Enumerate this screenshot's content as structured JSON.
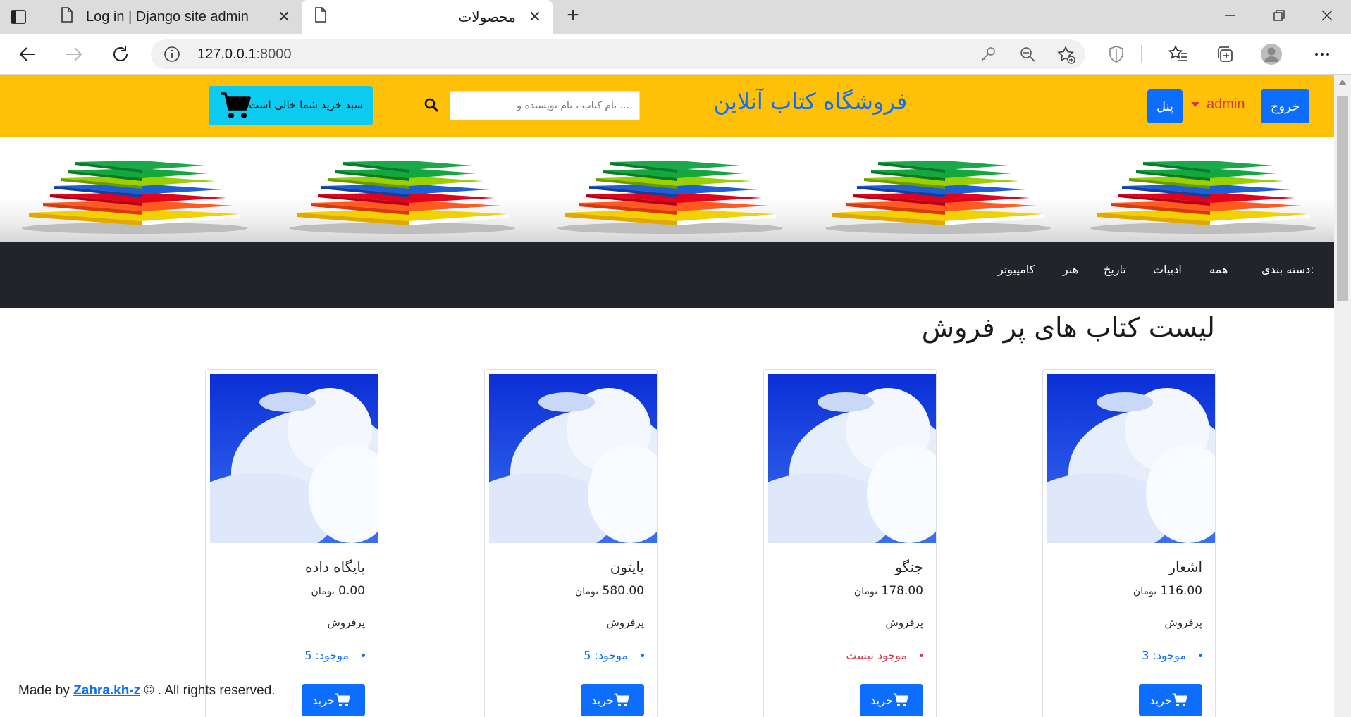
{
  "browser": {
    "tabs": [
      {
        "title": "Log in | Django site admin"
      },
      {
        "title": "محصولات"
      }
    ],
    "url_host": "127.0.0.1",
    "url_port": ":8000"
  },
  "header": {
    "logout_label": "خروج",
    "panel_label": "پنل",
    "user_label": "admin",
    "site_title": "فروشگاه کتاب آنلاین",
    "search_placeholder": "نام کتاب ، نام نویسنده و ...",
    "cart_label": "سبد خرید شما خالی است"
  },
  "categories": {
    "label": "دسته بندی:",
    "items": [
      "همه",
      "ادبیات",
      "تاریخ",
      "هنر",
      "کامپیوتر"
    ]
  },
  "main": {
    "list_title": "لیست کتاب های پر فروش",
    "products": [
      {
        "name": "اشعار",
        "price": "116.00",
        "currency": "تومان",
        "tag": "پرفروش",
        "stock": "موجود: 3",
        "in_stock": true,
        "buy_label": "خرید"
      },
      {
        "name": "جنگو",
        "price": "178.00",
        "currency": "تومان",
        "tag": "پرفروش",
        "stock": "موجود نیست",
        "in_stock": false,
        "buy_label": "خرید"
      },
      {
        "name": "پایتون",
        "price": "580.00",
        "currency": "تومان",
        "tag": "پرفروش",
        "stock": "موجود: 5",
        "in_stock": true,
        "buy_label": "خرید"
      },
      {
        "name": "پایگاه داده",
        "price": "0.00",
        "currency": "تومان",
        "tag": "پرفروش",
        "stock": "موجود: 5",
        "in_stock": true,
        "buy_label": "خرید"
      }
    ]
  },
  "footer": {
    "prefix": "Made by",
    "author": "Zahra.kh-z",
    "suffix": "© . All rights reserved."
  },
  "colors": {
    "header_bg": "#ffc107",
    "primary": "#0d6efd",
    "info": "#0dcaf0",
    "danger": "#dc3545",
    "dark": "#212529"
  }
}
